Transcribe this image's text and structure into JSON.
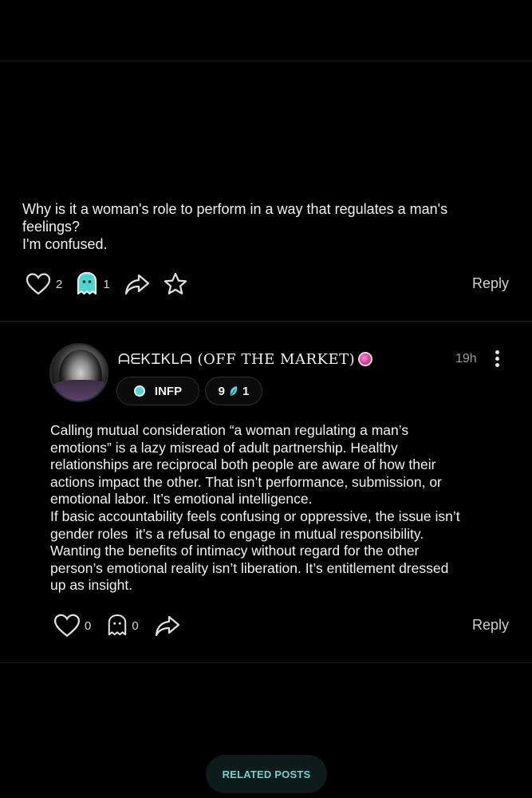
{
  "post": {
    "text_lines": [
      "Why is it a woman's role to perform in a way that regulates a man's",
      "feelings?",
      "I'm confused."
    ],
    "likes": "2",
    "ghosts": "1",
    "reply_label": "Reply"
  },
  "comment": {
    "username": "ᗩᗴᏦᏆᏦᏞᗩ (OFF THE MARKET)",
    "time": "19h",
    "personality": "INFP",
    "level": "9",
    "level_badge": "1",
    "text_lines": [
      "Calling mutual consideration “a woman regulating a man’s",
      "emotions” is a lazy misread of adult partnership. Healthy",
      "relationships are reciprocal both people are aware of how their",
      "actions impact the other. That isn’t performance, submission, or",
      "emotional labor. It’s emotional intelligence.",
      "If basic accountability feels confusing or oppressive, the issue isn’t",
      "gender roles  it’s a refusal to engage in mutual responsibility.",
      "Wanting the benefits of intimacy without regard for the other",
      "person’s emotional reality isn’t liberation. It’s entitlement dressed",
      "up as insight."
    ],
    "likes": "0",
    "ghosts": "0",
    "reply_label": "Reply"
  },
  "related_posts_label": "RELATED POSTS",
  "colors": {
    "accent": "#4bd6cf",
    "background": "#000000",
    "related_bg": "#0d1b1b"
  },
  "icons": [
    "heart-icon",
    "ghost-icon",
    "share-icon",
    "star-icon",
    "more-icon",
    "leaf-icon"
  ]
}
